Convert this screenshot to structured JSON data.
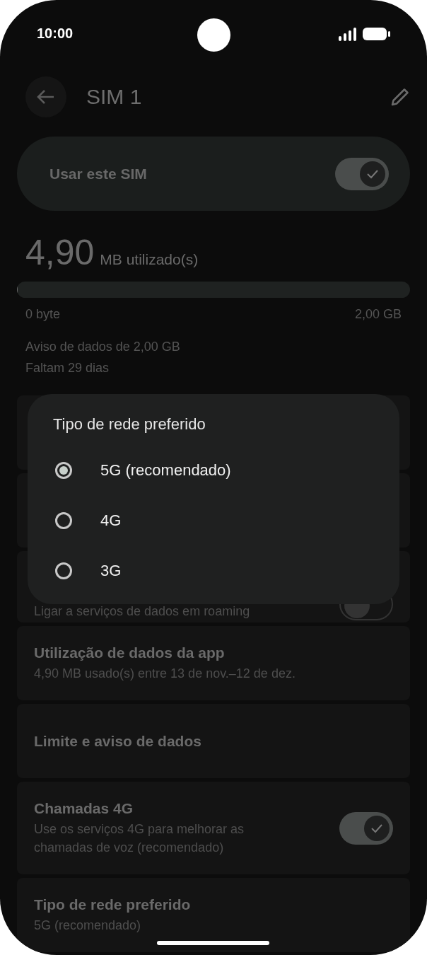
{
  "status_bar": {
    "time": "10:00"
  },
  "header": {
    "title": "SIM 1"
  },
  "use_sim": {
    "label": "Usar este SIM",
    "on": true
  },
  "usage": {
    "amount": "4,90",
    "unit": "MB utilizado(s)",
    "level": 0.002,
    "min_label": "0 byte",
    "max_label": "2,00 GB",
    "warning": "Aviso de dados de 2,00 GB",
    "remaining": "Faltam 29 dias"
  },
  "settings": [
    {
      "kind": "blank"
    },
    {
      "kind": "blank"
    },
    {
      "kind": "toggle",
      "subtitle": "Ligar a serviços de dados em roaming",
      "on": false
    },
    {
      "kind": "text",
      "title": "Utilização de dados da app",
      "subtitle": "4,90 MB usado(s) entre 13 de nov.–12 de dez."
    },
    {
      "kind": "text",
      "title": "Limite e aviso de dados"
    },
    {
      "kind": "toggle",
      "title": "Chamadas 4G",
      "subtitle": "Use os serviços 4G para melhorar as chamadas de voz (recomendado)",
      "on": true
    },
    {
      "kind": "text",
      "title": "Tipo de rede preferido",
      "subtitle": "5G (recomendado)"
    }
  ],
  "dialog": {
    "title": "Tipo de rede preferido",
    "options": [
      {
        "label": "5G (recomendado)",
        "selected": true
      },
      {
        "label": "4G",
        "selected": false
      },
      {
        "label": "3G",
        "selected": false
      }
    ]
  }
}
